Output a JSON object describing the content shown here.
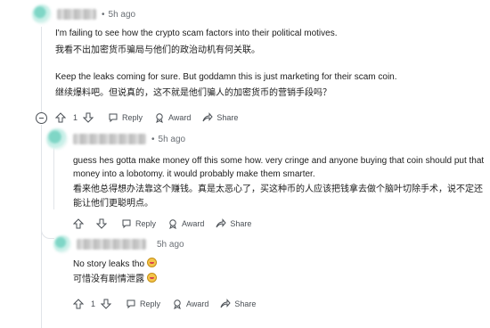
{
  "comments": [
    {
      "time": "5h ago",
      "lines": [
        "I'm failing to see how the crypto scam factors into their political motives.",
        "我看不出加密货币骗局与他们的政治动机有何关联。",
        "Keep the leaks coming for sure. But goddamn this is just marketing for their scam coin.",
        "继续爆料吧。但说真的，这不就是他们骗人的加密货币的营销手段吗？"
      ],
      "votes": "1",
      "actions": [
        "Reply",
        "Award",
        "Share"
      ]
    },
    {
      "time": "5h ago",
      "lines": [
        "guess hes gotta make money off this some how. very cringe and anyone buying that coin should put that",
        "money into a lobotomy. it would probably make them smarter.",
        "看来他总得想办法靠这个赚钱。真是太恶心了，买这种币的人应该把钱拿去做个脑叶切除手术，说不定还",
        "能让他们更聪明点。"
      ],
      "votes": "",
      "actions": [
        "Reply",
        "Award",
        "Share"
      ]
    },
    {
      "time": "5h ago",
      "lines": [
        "No story leaks tho",
        "可惜没有剧情泄露"
      ],
      "votes": "1",
      "actions": [
        "Reply",
        "Award",
        "Share"
      ]
    }
  ],
  "icons": {
    "upvote": "arrow-up-icon",
    "downvote": "arrow-down-icon",
    "reply": "speech-bubble-icon",
    "award": "award-ribbon-icon",
    "share": "share-arrow-icon",
    "collapse": "collapse-minus-icon"
  }
}
